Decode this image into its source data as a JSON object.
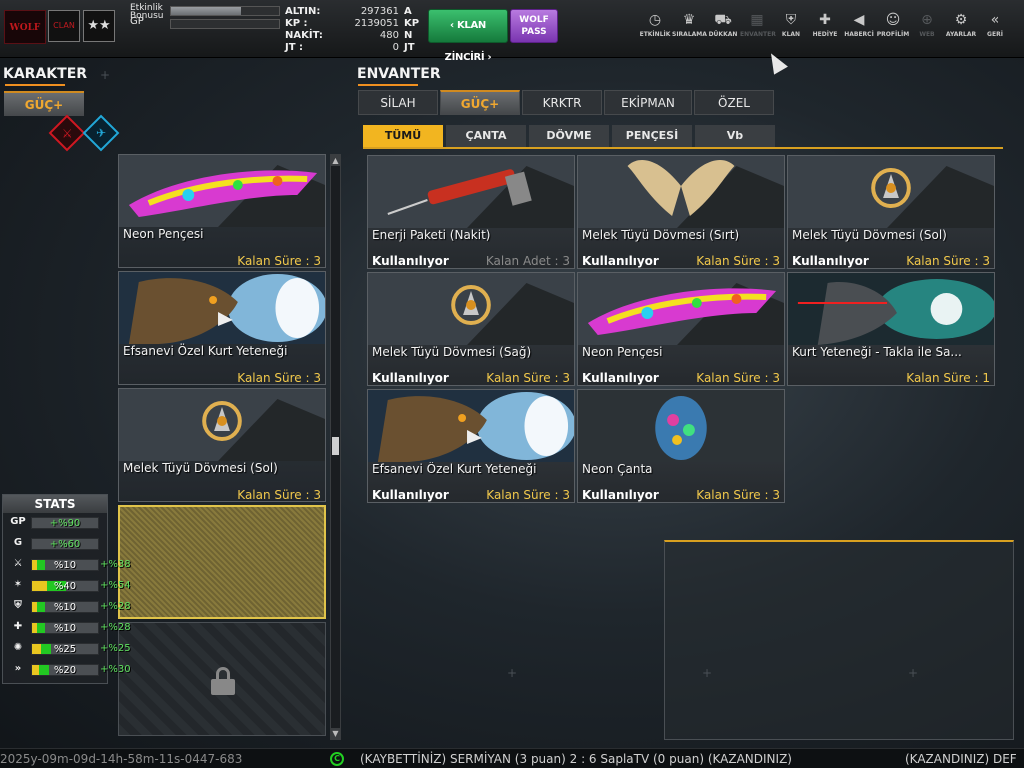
{
  "topbar": {
    "logo_text": "WOLF",
    "rank_badge_text": "CLAN",
    "stars": "★★",
    "xp": [
      {
        "label": "Etkinlik Bonusu",
        "fill": 0.65
      },
      {
        "label": "GP",
        "fill": 0.0
      }
    ],
    "player_name": "",
    "currencies": [
      {
        "name": "ALTIN:",
        "value": "297361",
        "unit": "A"
      },
      {
        "name": "KP :",
        "value": "2139051",
        "unit": "KP"
      },
      {
        "name": "NAKİT:",
        "value": "480",
        "unit": "N"
      },
      {
        "name": "JT :",
        "value": "0",
        "unit": "JT"
      }
    ],
    "clan_button": "‹ KLAN ZİNCİRİ ›",
    "wolf_pass_line1": "WOLF",
    "wolf_pass_line2": "PASS",
    "nav": [
      {
        "label": "ETKİNLİK",
        "icon": "stopwatch-icon",
        "glyph": "◷",
        "disabled": false
      },
      {
        "label": "SIRALAMA",
        "icon": "medal-icon",
        "glyph": "♛",
        "disabled": false
      },
      {
        "label": "DÜKKAN",
        "icon": "cart-icon",
        "glyph": "⛟",
        "disabled": false
      },
      {
        "label": "ENVANTER",
        "icon": "inventory-icon",
        "glyph": "▦",
        "disabled": true
      },
      {
        "label": "KLAN",
        "icon": "shield-icon",
        "glyph": "⛨",
        "disabled": false
      },
      {
        "label": "HEDİYE",
        "icon": "gift-icon",
        "glyph": "✚",
        "disabled": false
      },
      {
        "label": "HABERCİ",
        "icon": "megaphone-icon",
        "glyph": "◀",
        "disabled": false
      },
      {
        "label": "PROFİLİM",
        "icon": "profile-icon",
        "glyph": "☺",
        "disabled": false
      },
      {
        "label": "WEB",
        "icon": "globe-icon",
        "glyph": "⊕",
        "disabled": true
      },
      {
        "label": "AYARLAR",
        "icon": "gear-icon",
        "glyph": "⚙",
        "disabled": false
      },
      {
        "label": "GERİ",
        "icon": "back-icon",
        "glyph": "«",
        "disabled": false
      }
    ]
  },
  "character": {
    "title": "KARAKTER",
    "tab": "GÜÇ+",
    "slots": [
      {
        "name": "Neon Pençesi",
        "time": "Kalan Süre : 3",
        "art": "neon"
      },
      {
        "name": "Efsanevi Özel Kurt Yeteneği",
        "time": "Kalan Süre : 3",
        "art": "wolf"
      },
      {
        "name": "Melek Tüyü Dövmesi (Sol)",
        "time": "Kalan Süre : 3",
        "art": "emblem"
      }
    ]
  },
  "stats": {
    "title": "STATS",
    "rows": [
      {
        "icon": "GP",
        "name": "gp-stat",
        "value": "+%90",
        "green": true,
        "y": 0,
        "g": 0,
        "bonus": ""
      },
      {
        "icon": "G",
        "name": "g-stat",
        "value": "+%60",
        "green": true,
        "y": 0,
        "g": 0,
        "bonus": ""
      },
      {
        "icon": "⚔",
        "name": "attack-stat",
        "value": "%10",
        "green": false,
        "y": 0.07,
        "g": 0.13,
        "bonus": "+%38"
      },
      {
        "icon": "✶",
        "name": "speed-stat",
        "value": "%40",
        "green": false,
        "y": 0.22,
        "g": 0.3,
        "bonus": "+%54"
      },
      {
        "icon": "⛨",
        "name": "defense-stat",
        "value": "%10",
        "green": false,
        "y": 0.07,
        "g": 0.13,
        "bonus": "+%28"
      },
      {
        "icon": "✚",
        "name": "health-stat",
        "value": "%10",
        "green": false,
        "y": 0.07,
        "g": 0.13,
        "bonus": "+%28"
      },
      {
        "icon": "✺",
        "name": "skill-stat",
        "value": "%25",
        "green": false,
        "y": 0.13,
        "g": 0.16,
        "bonus": "+%25"
      },
      {
        "icon": "»",
        "name": "dash-stat",
        "value": "%20",
        "green": false,
        "y": 0.1,
        "g": 0.16,
        "bonus": "+%30"
      }
    ]
  },
  "inventory": {
    "title": "ENVANTER",
    "tabs": [
      "SİLAH",
      "GÜÇ+",
      "KRKTR",
      "EKİPMAN",
      "ÖZEL"
    ],
    "active_tab": 1,
    "subtabs": [
      "TÜMÜ",
      "ÇANTA",
      "DÖVME",
      "PENÇESİ",
      "Vb"
    ],
    "active_subtab": 0,
    "items": [
      {
        "name": "Enerji Paketi (Nakit)",
        "status": "Kullanılıyor",
        "time": "Kalan Adet : 3",
        "grey": true,
        "art": "syringe"
      },
      {
        "name": "Melek Tüyü Dövmesi (Sırt)",
        "status": "Kullanılıyor",
        "time": "Kalan Süre : 3",
        "grey": false,
        "art": "wings"
      },
      {
        "name": "Melek Tüyü Dövmesi (Sol)",
        "status": "Kullanılıyor",
        "time": "Kalan Süre : 3",
        "grey": false,
        "art": "emblem"
      },
      {
        "name": "Melek Tüyü Dövmesi (Sağ)",
        "status": "Kullanılıyor",
        "time": "Kalan Süre : 3",
        "grey": false,
        "art": "emblem"
      },
      {
        "name": "Neon Pençesi",
        "status": "Kullanılıyor",
        "time": "Kalan Süre : 3",
        "grey": false,
        "art": "neon"
      },
      {
        "name": "Kurt Yeteneği - Takla ile Sa...",
        "status": "",
        "time": "Kalan Süre : 1",
        "grey": false,
        "art": "wolfblue"
      },
      {
        "name": "Efsanevi Özel Kurt Yeteneği",
        "status": "Kullanılıyor",
        "time": "Kalan Süre : 3",
        "grey": false,
        "art": "wolf"
      },
      {
        "name": "Neon Çanta",
        "status": "Kullanılıyor",
        "time": "Kalan Süre : 3",
        "grey": false,
        "art": "bag"
      }
    ]
  },
  "ticker": {
    "left": "2025y-09m-09d-14h-58m-11s-0447-683",
    "clan_icon": "C",
    "middle": "(KAYBETTİNİZ) SERMİYAN (3 puan) 2 : 6 SaplaTV (0 puan) (KAZANDINIZ)",
    "right": "(KAZANDINIZ) DEF"
  },
  "colors": {
    "accent_orange": "#f09020",
    "gold_text": "#f2c94c",
    "active_subtab": "#f2b520",
    "clan_green": "#22a050",
    "wolf_purple": "#9a55c8"
  }
}
